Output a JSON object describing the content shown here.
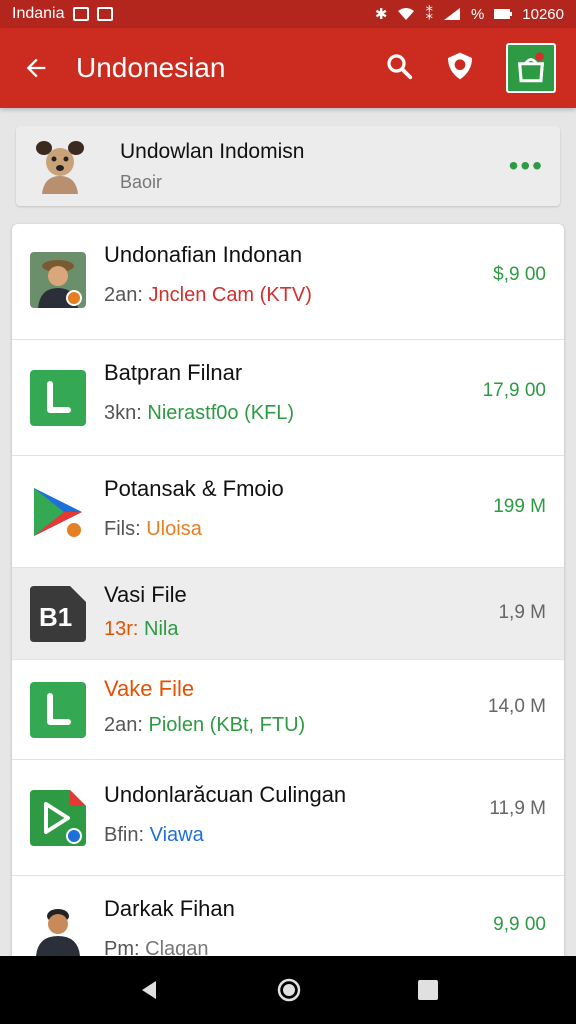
{
  "status_bar": {
    "carrier": "Indania",
    "battery_pct": "%",
    "time": "10260"
  },
  "app_bar": {
    "title": "Undonesian"
  },
  "account": {
    "name": "Undowlan Indomisn",
    "subtitle": "Baoir",
    "more": "•••"
  },
  "items": [
    {
      "name": "Undonafian Indonan",
      "sub_prefix": "2an:",
      "sub_value": "Jnclen Cam (KTV)",
      "sub_color": "#d32f2f",
      "size": "$,9 00",
      "size_color": "#2e9a43",
      "icon": "person-avatar-icon"
    },
    {
      "name": "Batpran Filnar",
      "sub_prefix": "3kn:",
      "sub_value": "Nierastf0o (KFL)",
      "sub_color": "#2e9a43",
      "size": "17,9 00",
      "size_color": "#2e9a43",
      "icon": "green-app-icon"
    },
    {
      "name": "Potansak & Fmoio",
      "sub_prefix": "Fils:",
      "sub_value": "Uloisa",
      "sub_color": "#e67e22",
      "size": "199 M",
      "size_color": "#2e9a43",
      "icon": "play-store-icon"
    },
    {
      "name": "Vasi File",
      "sub_prefix": "13r:",
      "sub_value": "Nila",
      "sub_color": "#2e9a43",
      "size": "1,9 M",
      "size_color": "#666666",
      "icon": "dark-app-icon"
    },
    {
      "name": "Vake File",
      "sub_prefix": "2an:",
      "sub_value": "Piolen (KBt, FTU)",
      "sub_color": "#2e9a43",
      "size": "14,0 M",
      "size_color": "#666666",
      "icon": "green-app-icon",
      "name_color": "#e65100"
    },
    {
      "name": "Undonlarăcuan Culingan",
      "sub_prefix": "Bfin:",
      "sub_value": "Viawa",
      "sub_color": "#1e6fd9",
      "size": "11,9 M",
      "size_color": "#666666",
      "icon": "play-video-icon"
    },
    {
      "name": "Darkak Fihan",
      "sub_prefix": "Pm:",
      "sub_value": "Clagan",
      "sub_color": "#777777",
      "size": "9,9 00",
      "size_color": "#2e9a43",
      "icon": "person-avatar-icon"
    }
  ]
}
